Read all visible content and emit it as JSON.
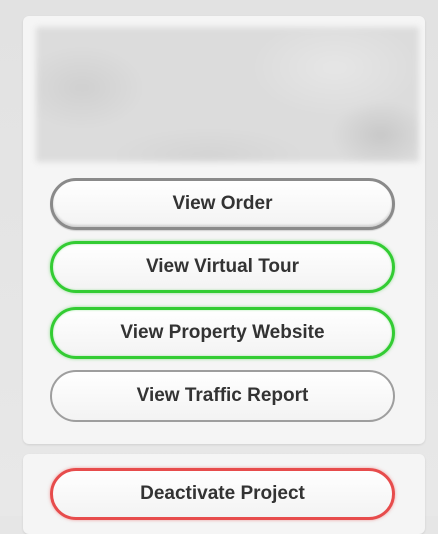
{
  "actions": {
    "view_order": "View Order",
    "view_virtual_tour": "View Virtual Tour",
    "view_property_website": "View Property Website",
    "view_traffic_report": "View Traffic Report",
    "deactivate_project": "Deactivate Project"
  },
  "colors": {
    "neutral_border": "#8a8a8a",
    "green_border": "#33cc33",
    "red_border": "#e74c4c"
  }
}
